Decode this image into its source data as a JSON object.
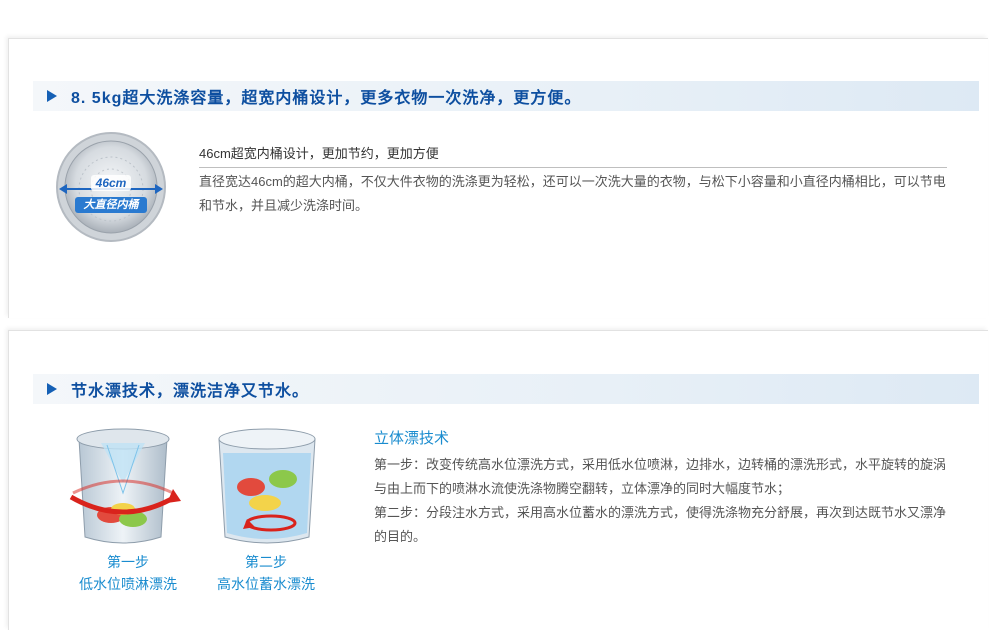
{
  "section1": {
    "banner_title": "8. 5kg超大洗涤容量，超宽内桶设计，更多衣物一次洗净，更方便。",
    "drum_size_label": "46cm",
    "drum_caption": "大直径内桶",
    "feature_title": "46cm超宽内桶设计，更加节约，更加方便",
    "feature_desc": "直径宽达46cm的超大内桶，不仅大件衣物的洗涤更为轻松，还可以一次洗大量的衣物，与松下小容量和小直径内桶相比，可以节电和节水，并且减少洗涤时间。"
  },
  "section2": {
    "banner_title": "节水漂技术，漂洗洁净又节水。",
    "steps": [
      {
        "label": "第一步",
        "caption": "低水位喷淋漂洗"
      },
      {
        "label": "第二步",
        "caption": "高水位蓄水漂洗"
      }
    ],
    "rinse_title": "立体漂技术",
    "rinse_paragraphs": [
      "第一步：改变传统高水位漂洗方式，采用低水位喷淋，边排水，边转桶的漂洗形式，水平旋转的旋涡与由上而下的喷淋水流使洗涤物腾空翻转，立体漂净的同时大幅度节水；",
      "第二步：分段注水方式，采用高水位蓄水的漂洗方式，使得洗涤物充分舒展，再次到达既节水又漂净的目的。"
    ]
  },
  "colors": {
    "banner_text": "#0e4fa0",
    "accent_blue": "#1a8ccf",
    "arrow_red": "#d9231c"
  },
  "icons": [
    "play-triangle-icon",
    "drum-icon",
    "tub-spray-icon",
    "tub-fill-icon"
  ]
}
